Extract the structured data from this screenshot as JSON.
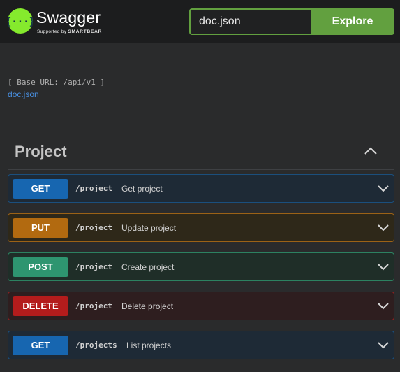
{
  "topbar": {
    "brand_name": "Swagger",
    "brand_supported": "Supported by",
    "brand_company": "SMARTBEAR",
    "search_value": "doc.json",
    "explore_label": "Explore"
  },
  "info": {
    "base_url": "[ Base URL: /api/v1 ]",
    "spec_link": "doc.json"
  },
  "section": {
    "title": "Project"
  },
  "operations": [
    {
      "method": "GET",
      "path": "/project",
      "summary": "Get project"
    },
    {
      "method": "PUT",
      "path": "/project",
      "summary": "Update project"
    },
    {
      "method": "POST",
      "path": "/project",
      "summary": "Create project"
    },
    {
      "method": "DELETE",
      "path": "/project",
      "summary": "Delete project"
    },
    {
      "method": "GET",
      "path": "/projects",
      "summary": "List projects"
    }
  ],
  "colors": {
    "brand_green": "#62a03f",
    "get": "#1766b0",
    "put": "#b26a10",
    "post": "#2e9570",
    "delete": "#b41c1c",
    "link": "#4990e2"
  },
  "icons": {
    "logo": "swagger-logo",
    "section_toggle": "chevron-up-icon",
    "operation_toggle": "chevron-down-icon"
  }
}
